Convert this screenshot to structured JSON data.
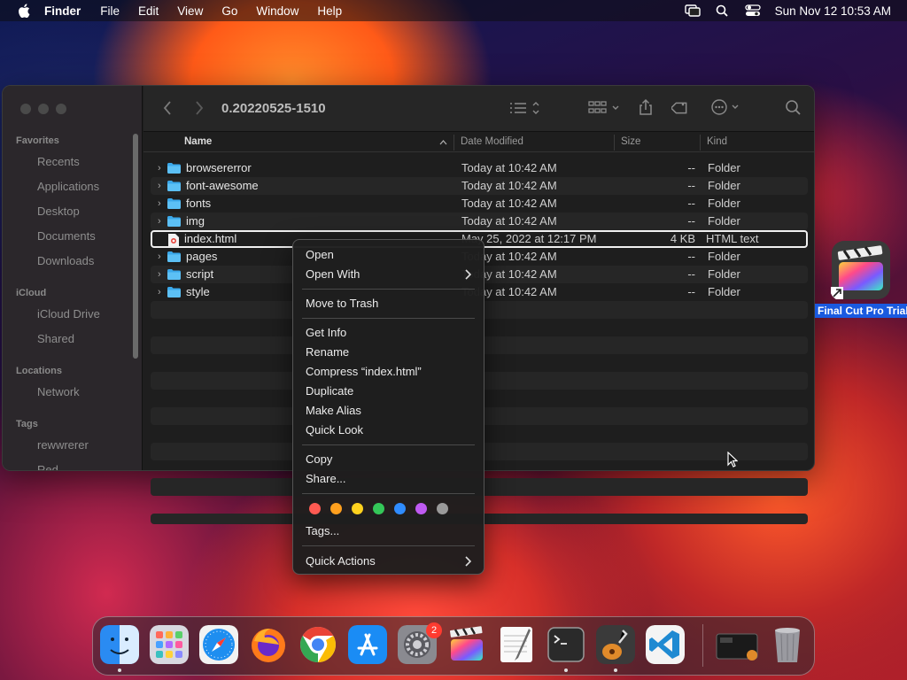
{
  "menubar": {
    "app": "Finder",
    "items": [
      "File",
      "Edit",
      "View",
      "Go",
      "Window",
      "Help"
    ],
    "clock": "Sun Nov 12  10:53 AM"
  },
  "window": {
    "title": "0.20220525-1510",
    "sidebar": {
      "favorites_label": "Favorites",
      "favorites": [
        "Recents",
        "Applications",
        "Desktop",
        "Documents",
        "Downloads"
      ],
      "icloud_label": "iCloud",
      "icloud": [
        "iCloud Drive",
        "Shared"
      ],
      "locations_label": "Locations",
      "locations": [
        "Network"
      ],
      "tags_label": "Tags",
      "tags": [
        "rewwrerer",
        "Red"
      ]
    },
    "columns": {
      "name": "Name",
      "date": "Date Modified",
      "size": "Size",
      "kind": "Kind"
    },
    "rows": [
      {
        "name": "browsererror",
        "date": "Today at 10:42 AM",
        "size": "--",
        "kind": "Folder"
      },
      {
        "name": "font-awesome",
        "date": "Today at 10:42 AM",
        "size": "--",
        "kind": "Folder"
      },
      {
        "name": "fonts",
        "date": "Today at 10:42 AM",
        "size": "--",
        "kind": "Folder"
      },
      {
        "name": "img",
        "date": "Today at 10:42 AM",
        "size": "--",
        "kind": "Folder"
      },
      {
        "name": "index.html",
        "date": "May 25, 2022 at 12:17 PM",
        "size": "4 KB",
        "kind": "HTML text"
      },
      {
        "name": "pages",
        "date": "Today at 10:42 AM",
        "size": "--",
        "kind": "Folder"
      },
      {
        "name": "script",
        "date": "Today at 10:42 AM",
        "size": "--",
        "kind": "Folder"
      },
      {
        "name": "style",
        "date": "Today at 10:42 AM",
        "size": "--",
        "kind": "Folder"
      }
    ]
  },
  "context_menu": {
    "open": "Open",
    "open_with": "Open With",
    "move_to_trash": "Move to Trash",
    "get_info": "Get Info",
    "rename": "Rename",
    "compress": "Compress “index.html”",
    "duplicate": "Duplicate",
    "make_alias": "Make Alias",
    "quick_look": "Quick Look",
    "copy": "Copy",
    "share": "Share...",
    "tags": "Tags...",
    "quick_actions": "Quick Actions",
    "tag_colors": [
      "#ff5a52",
      "#ffa01e",
      "#ffd21e",
      "#34c759",
      "#2f8cff",
      "#bf5af2",
      "#9a9a9a"
    ]
  },
  "desktop": {
    "icon_label": "Final Cut Pro Trial"
  },
  "dock": {
    "settings_badge": "2"
  }
}
